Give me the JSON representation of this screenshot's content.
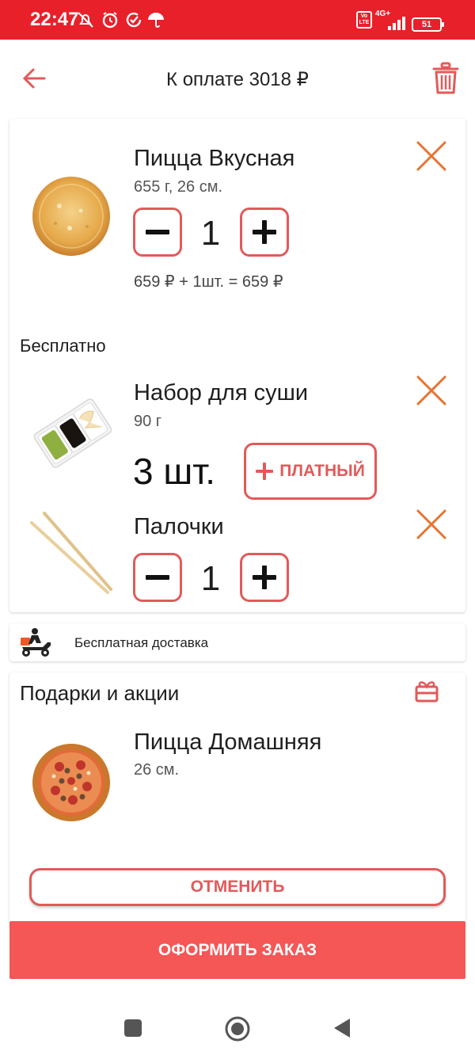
{
  "status_bar": {
    "time": "22:47",
    "network": "4G+",
    "volte": "Vo LTE",
    "battery": "51"
  },
  "header": {
    "title": "К оплате 3018 ₽"
  },
  "cart": {
    "items": [
      {
        "name": "Пицца Вкусная",
        "details": "655 г, 26 см.",
        "quantity": "1",
        "price_line": "659 ₽ + 1шт. = 659 ₽"
      }
    ]
  },
  "free_section": {
    "label": "Бесплатно",
    "items": [
      {
        "name": "Набор для суши",
        "details": "90 г",
        "count_label": "3 шт.",
        "paid_button": "ПЛАТНЫЙ"
      },
      {
        "name": "Палочки",
        "quantity": "1"
      }
    ]
  },
  "delivery": {
    "label": "Бесплатная доставка"
  },
  "gifts": {
    "title": "Подарки и акции",
    "items": [
      {
        "name": "Пицца Домашняя",
        "details": "26 см."
      }
    ]
  },
  "actions": {
    "cancel": "ОТМЕНИТЬ",
    "order": "ОФОРМИТЬ ЗАКАЗ"
  },
  "colors": {
    "status_bar": "#e8202a",
    "accent": "#e25a5a",
    "primary_button": "#f55656",
    "remove_icon": "#e8732f"
  }
}
